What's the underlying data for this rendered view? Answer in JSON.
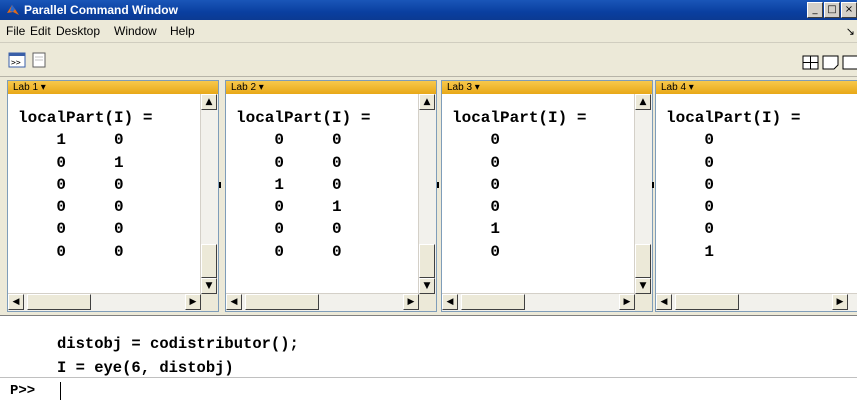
{
  "window": {
    "title": "Parallel Command Window"
  },
  "menu": [
    "File",
    "Edit",
    "Desktop",
    "Window",
    "Help"
  ],
  "labs": [
    {
      "header": "Lab 1 ▾",
      "lines": [
        "localPart(I) =",
        "    1     0",
        "    0     1",
        "    0     0",
        "    0     0",
        "    0     0",
        "    0     0"
      ]
    },
    {
      "header": "Lab 2 ▾",
      "lines": [
        "localPart(I) =",
        "    0     0",
        "    0     0",
        "    1     0",
        "    0     1",
        "    0     0",
        "    0     0"
      ]
    },
    {
      "header": "Lab 3 ▾",
      "lines": [
        "localPart(I) =",
        "    0",
        "    0",
        "    0",
        "    0",
        "    1",
        "    0"
      ]
    },
    {
      "header": "Lab 4 ▾",
      "lines": [
        "localPart(I) =",
        "    0",
        "    0",
        "    0",
        "    0",
        "    0",
        "    1"
      ]
    }
  ],
  "command_history": [
    "distobj = codistributor();",
    "I = eye(6, distobj)"
  ],
  "prompt": "P>>",
  "colors": {
    "titlebar": "#0a3fa0",
    "lab_header": "#f0b830",
    "chrome": "#ece9d8"
  }
}
